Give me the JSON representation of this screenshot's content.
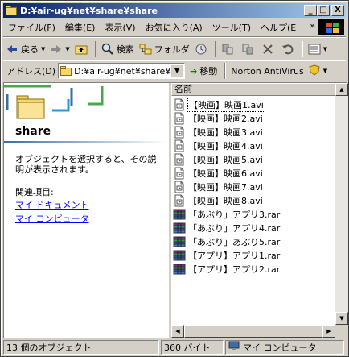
{
  "window": {
    "title": "D:¥air-ug¥net¥share¥share",
    "min_glyph": "_",
    "max_glyph": "□",
    "close_glyph": "X"
  },
  "menu": [
    "ファイル(F)",
    "編集(E)",
    "表示(V)",
    "お気に入り(A)",
    "ツール(T)",
    "ヘルプ(E"
  ],
  "menu_more": "»",
  "toolbar": {
    "back_label": "戻る",
    "search_label": "検索",
    "folder_label": "フォルダ"
  },
  "address": {
    "label": "アドレス(D)",
    "value": "D:¥air-ug¥net¥share¥share",
    "go_label": "移動",
    "links_label": "Norton AntiVirus"
  },
  "left_pane": {
    "folder_name": "share",
    "description": "オブジェクトを選択すると、その説明が表示されます。",
    "related_title": "関連項目:",
    "links": [
      "マイ ドキュメント",
      "マイ コンピュータ"
    ]
  },
  "list": {
    "column_header": "名前",
    "files": [
      {
        "name": "【映画】映画1.avi",
        "type": "avi"
      },
      {
        "name": "【映画】映画2.avi",
        "type": "avi"
      },
      {
        "name": "【映画】映画3.avi",
        "type": "avi"
      },
      {
        "name": "【映画】映画4.avi",
        "type": "avi"
      },
      {
        "name": "【映画】映画5.avi",
        "type": "avi"
      },
      {
        "name": "【映画】映画6.avi",
        "type": "avi"
      },
      {
        "name": "【映画】映画7.avi",
        "type": "avi"
      },
      {
        "name": "【映画】映画8.avi",
        "type": "avi"
      },
      {
        "name": "「あぶり」アプリ3.rar",
        "type": "rar"
      },
      {
        "name": "「あぶり」アプリ4.rar",
        "type": "rar"
      },
      {
        "name": "「あぶり」あぶり5.rar",
        "type": "rar"
      },
      {
        "name": "【アプリ】アプリ1.rar",
        "type": "rar"
      },
      {
        "name": "【アプリ】アプリ2.rar",
        "type": "rar"
      }
    ]
  },
  "status": {
    "count": "13 個のオブジェクト",
    "size": "360 バイト",
    "location": "マイ コンピュータ"
  }
}
